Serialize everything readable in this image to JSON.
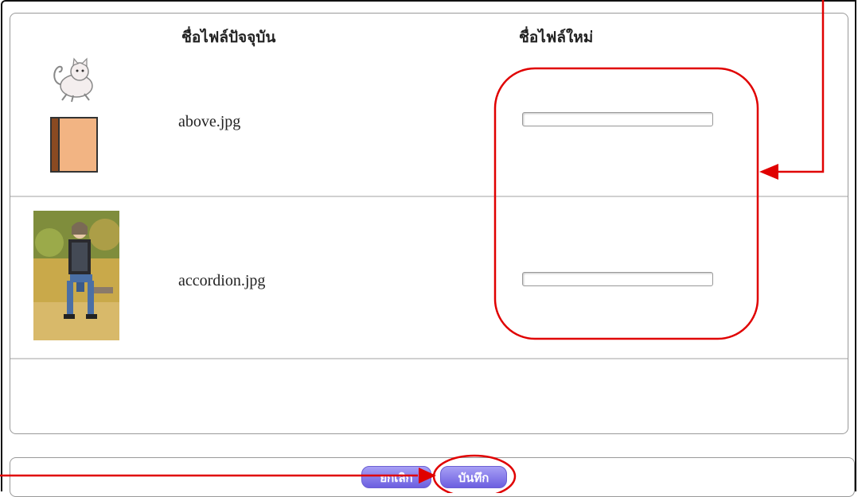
{
  "table": {
    "header_current": "ชื่อไฟล์ปัจจุบัน",
    "header_new": "ชื่อไฟล์ใหม่",
    "rows": [
      {
        "current_name": "above.jpg",
        "new_name_value": ""
      },
      {
        "current_name": "accordion.jpg",
        "new_name_value": ""
      }
    ]
  },
  "actions": {
    "cancel_label": "ยกเลิก",
    "save_label": "บันทึก"
  },
  "annotation_color": "#e00000",
  "button_color": "#7b6ee6"
}
